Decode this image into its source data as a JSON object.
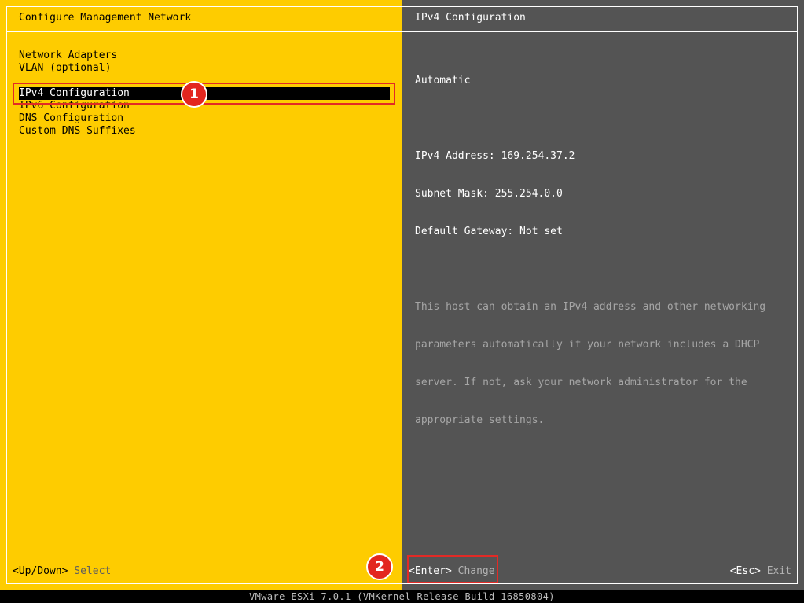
{
  "left_panel": {
    "title": "Configure Management Network",
    "menu": [
      "Network Adapters",
      "VLAN (optional)",
      "IPv4 Configuration",
      "IPv6 Configuration",
      "DNS Configuration",
      "Custom DNS Suffixes"
    ],
    "selected_index": 2,
    "footer_key": "<Up/Down>",
    "footer_action": "Select"
  },
  "right_panel": {
    "title": "IPv4 Configuration",
    "mode": "Automatic",
    "ipv4_address": "IPv4 Address: 169.254.37.2",
    "subnet_mask": "Subnet Mask: 255.254.0.0",
    "default_gateway": "Default Gateway: Not set",
    "description": [
      "This host can obtain an IPv4 address and other networking",
      "parameters automatically if your network includes a DHCP",
      "server. If not, ask your network administrator for the",
      "appropriate settings."
    ],
    "enter_key": "<Enter>",
    "enter_action": "Change",
    "esc_key": "<Esc>",
    "esc_action": "Exit"
  },
  "annotations": {
    "badge1": "1",
    "badge2": "2"
  },
  "status_bar": "VMware ESXi 7.0.1 (VMKernel Release Build 16850804)",
  "colors": {
    "left_bg": "#fecc00",
    "right_bg": "#545454",
    "annotation_red": "#e3261f"
  }
}
